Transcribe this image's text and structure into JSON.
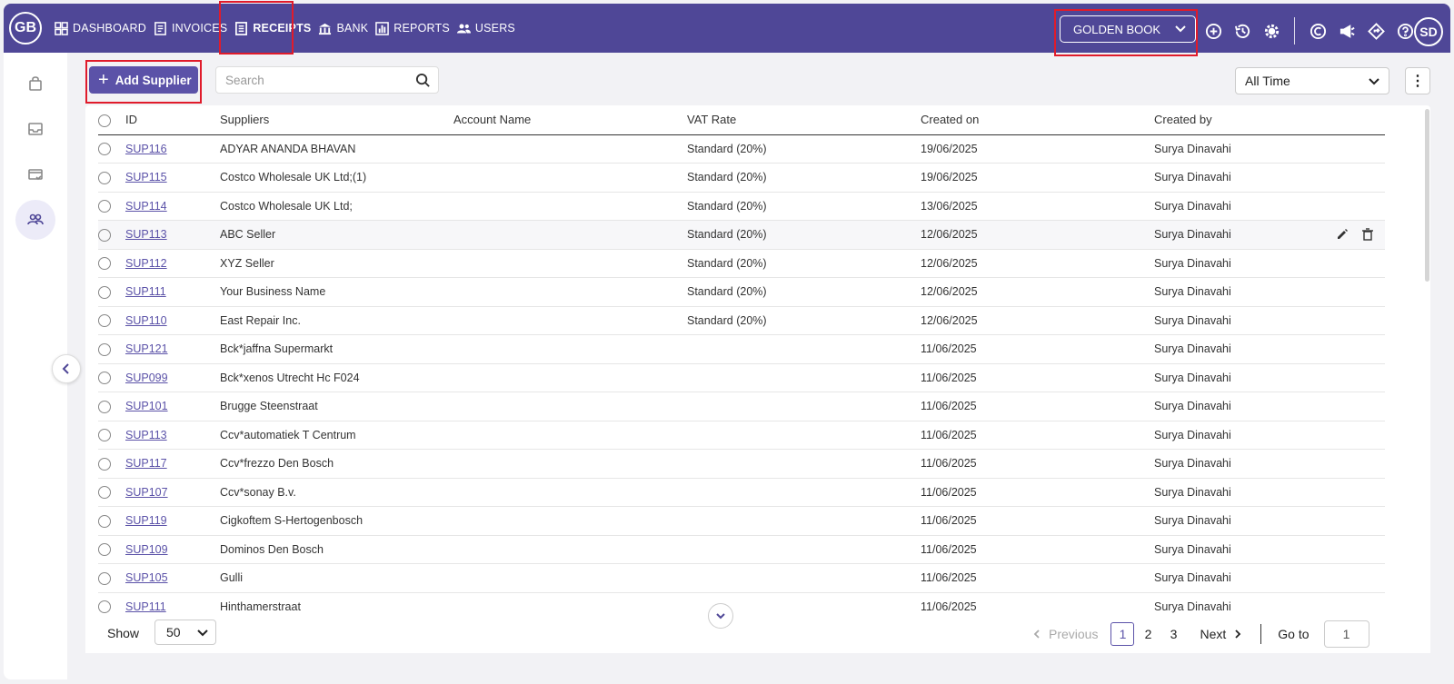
{
  "header": {
    "logo": "GB",
    "nav": [
      {
        "label": "DASHBOARD",
        "icon": "dashboard-icon"
      },
      {
        "label": "INVOICES",
        "icon": "invoice-icon"
      },
      {
        "label": "RECEIPTS",
        "icon": "receipt-icon",
        "active": true
      },
      {
        "label": "BANK",
        "icon": "bank-icon"
      },
      {
        "label": "REPORTS",
        "icon": "reports-icon"
      },
      {
        "label": "USERS",
        "icon": "users-icon"
      }
    ],
    "company": "GOLDEN BOOK",
    "user_initials": "SD",
    "accent": "#4f4797"
  },
  "toolbar": {
    "add_label": "Add Supplier",
    "search_placeholder": "Search",
    "time_filter": "All Time"
  },
  "table": {
    "columns": [
      "ID",
      "Suppliers",
      "Account Name",
      "VAT Rate",
      "Created on",
      "Created by"
    ],
    "rows": [
      {
        "id": "SUP116",
        "supplier": "ADYAR ANANDA BHAVAN",
        "account": "",
        "vat": "Standard (20%)",
        "created": "19/06/2025",
        "by": "Surya Dinavahi"
      },
      {
        "id": "SUP115",
        "supplier": "Costco Wholesale UK Ltd;(1)",
        "account": "",
        "vat": "Standard (20%)",
        "created": "19/06/2025",
        "by": "Surya Dinavahi"
      },
      {
        "id": "SUP114",
        "supplier": "Costco Wholesale UK Ltd;",
        "account": "",
        "vat": "Standard (20%)",
        "created": "13/06/2025",
        "by": "Surya Dinavahi"
      },
      {
        "id": "SUP113",
        "supplier": "ABC Seller",
        "account": "",
        "vat": "Standard (20%)",
        "created": "12/06/2025",
        "by": "Surya Dinavahi"
      },
      {
        "id": "SUP112",
        "supplier": "XYZ Seller",
        "account": "",
        "vat": "Standard (20%)",
        "created": "12/06/2025",
        "by": "Surya Dinavahi"
      },
      {
        "id": "SUP111",
        "supplier": "Your Business Name",
        "account": "",
        "vat": "Standard (20%)",
        "created": "12/06/2025",
        "by": "Surya Dinavahi"
      },
      {
        "id": "SUP110",
        "supplier": "East Repair Inc.",
        "account": "",
        "vat": "Standard (20%)",
        "created": "12/06/2025",
        "by": "Surya Dinavahi"
      },
      {
        "id": "SUP121",
        "supplier": "Bck*jaffna Supermarkt",
        "account": "",
        "vat": "",
        "created": "11/06/2025",
        "by": "Surya Dinavahi"
      },
      {
        "id": "SUP099",
        "supplier": "Bck*xenos Utrecht Hc F024",
        "account": "",
        "vat": "",
        "created": "11/06/2025",
        "by": "Surya Dinavahi"
      },
      {
        "id": "SUP101",
        "supplier": "Brugge Steenstraat",
        "account": "",
        "vat": "",
        "created": "11/06/2025",
        "by": "Surya Dinavahi"
      },
      {
        "id": "SUP113",
        "supplier": "Ccv*automatiek T Centrum",
        "account": "",
        "vat": "",
        "created": "11/06/2025",
        "by": "Surya Dinavahi"
      },
      {
        "id": "SUP117",
        "supplier": "Ccv*frezzo Den Bosch",
        "account": "",
        "vat": "",
        "created": "11/06/2025",
        "by": "Surya Dinavahi"
      },
      {
        "id": "SUP107",
        "supplier": "Ccv*sonay B.v.",
        "account": "",
        "vat": "",
        "created": "11/06/2025",
        "by": "Surya Dinavahi"
      },
      {
        "id": "SUP119",
        "supplier": "Cigkoftem S-Hertogenbosch",
        "account": "",
        "vat": "",
        "created": "11/06/2025",
        "by": "Surya Dinavahi"
      },
      {
        "id": "SUP109",
        "supplier": "Dominos Den Bosch",
        "account": "",
        "vat": "",
        "created": "11/06/2025",
        "by": "Surya Dinavahi"
      },
      {
        "id": "SUP105",
        "supplier": "Gulli",
        "account": "",
        "vat": "",
        "created": "11/06/2025",
        "by": "Surya Dinavahi"
      },
      {
        "id": "SUP111",
        "supplier": "Hinthamerstraat",
        "account": "",
        "vat": "",
        "created": "11/06/2025",
        "by": "Surya Dinavahi"
      }
    ],
    "hover_row": 3
  },
  "footer": {
    "show_label": "Show",
    "page_size": "50",
    "prev_label": "Previous",
    "pages": [
      "1",
      "2",
      "3"
    ],
    "current_page": "1",
    "next_label": "Next",
    "goto_label": "Go to",
    "goto_value": "1"
  }
}
